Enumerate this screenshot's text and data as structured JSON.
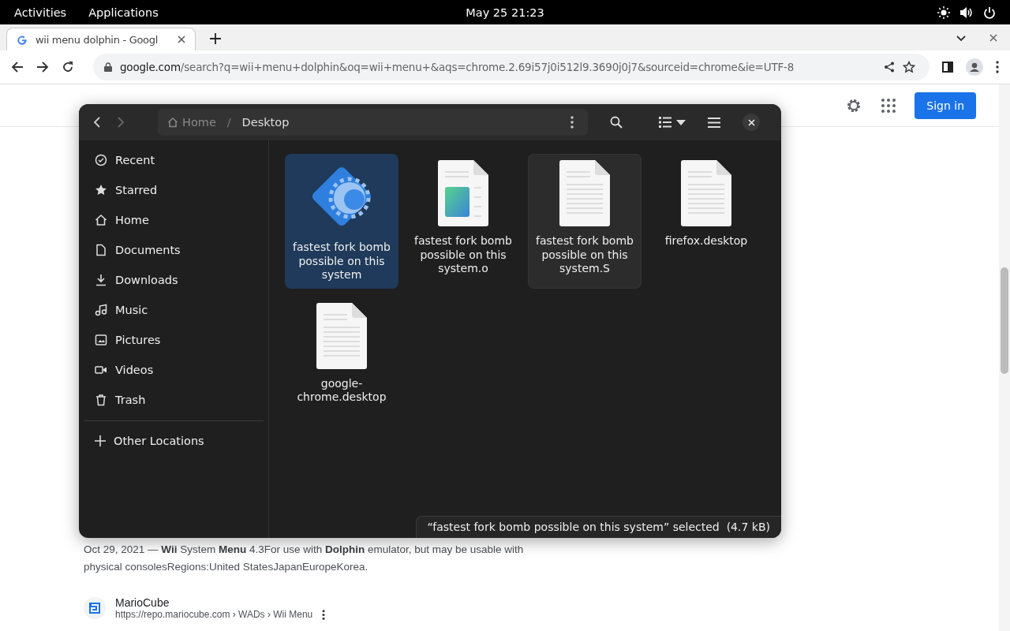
{
  "top_bar": {
    "activities": "Activities",
    "applications": "Applications",
    "clock": "May 25  21:23"
  },
  "browser": {
    "tab": {
      "title": "wii menu dolphin - Googl",
      "selected": true
    },
    "url_host": "google.com",
    "url_rest": "/search?q=wii+menu+dolphin&oq=wii+menu+&aqs=chrome.2.69i57j0i512l9.3690j0j7&sourceid=chrome&ie=UTF-8"
  },
  "page": {
    "sign_in": "Sign in",
    "snippet": "Oct 29, 2021 — **Wii** System **Menu** 4.3For use with **Dolphin** emulator, but may be usable with physical consolesRegions:United StatesJapanEuropeKorea.",
    "result": {
      "site": "MarioCube",
      "breadcrumb": "https://repo.mariocube.com › WADs › Wii Menu"
    }
  },
  "file_dialog": {
    "path_separator": "/",
    "path": [
      {
        "label": "Home",
        "kind": "home"
      },
      {
        "label": "Desktop",
        "kind": "folder"
      }
    ],
    "sidebar": [
      {
        "label": "Recent",
        "kind": "recent"
      },
      {
        "label": "Starred",
        "kind": "starred"
      },
      {
        "label": "Home",
        "kind": "home"
      },
      {
        "label": "Documents",
        "kind": "documents"
      },
      {
        "label": "Downloads",
        "kind": "downloads"
      },
      {
        "label": "Music",
        "kind": "music"
      },
      {
        "label": "Pictures",
        "kind": "pictures"
      },
      {
        "label": "Videos",
        "kind": "videos"
      },
      {
        "label": "Trash",
        "kind": "trash"
      }
    ],
    "other_locations": "Other Locations",
    "files": [
      {
        "name": "fastest fork bomb possible on this system",
        "kind": "app",
        "selected": true,
        "hovered": false
      },
      {
        "name": "fastest fork bomb possible on this system.o",
        "kind": "image-doc",
        "selected": false,
        "hovered": false
      },
      {
        "name": "fastest fork bomb possible on this system.S",
        "kind": "text-doc",
        "selected": false,
        "hovered": true
      },
      {
        "name": "firefox.desktop",
        "kind": "text-doc",
        "selected": false,
        "hovered": false
      },
      {
        "name": "google-chrome.desktop",
        "kind": "text-doc",
        "selected": false,
        "hovered": false
      }
    ],
    "status": "“fastest fork bomb possible on this system” selected  (4.7 kB)"
  }
}
